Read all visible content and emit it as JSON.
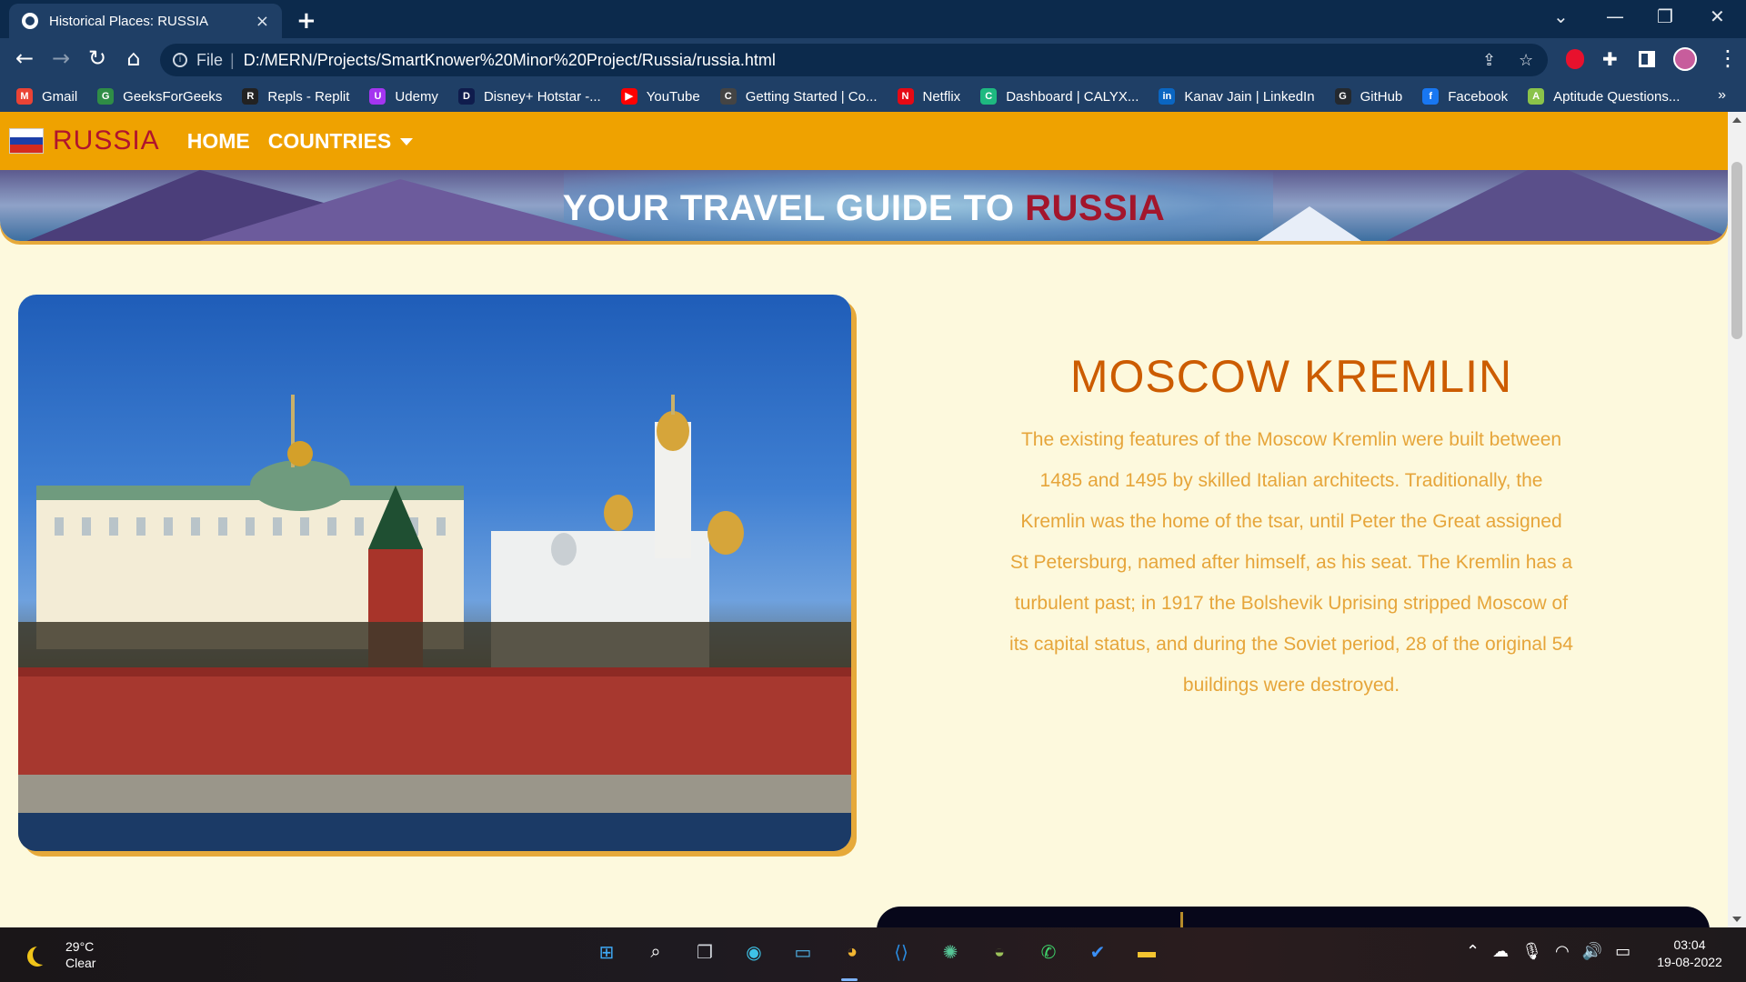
{
  "browser": {
    "tab_title": "Historical Places: RUSSIA",
    "tab_close": "×",
    "new_tab": "+",
    "url_prefix": "File",
    "url_separator": "|",
    "url": "D:/MERN/Projects/SmartKnower%20Minor%20Project/Russia/russia.html",
    "bookmarks": [
      {
        "label": "Gmail",
        "icon": "gmail-icon",
        "color": "#ea4335",
        "glyph": "M"
      },
      {
        "label": "GeeksForGeeks",
        "icon": "geeksforgeeks-icon",
        "color": "#2f8d46",
        "glyph": "G"
      },
      {
        "label": "Repls - Replit",
        "icon": "replit-icon",
        "color": "#222222",
        "glyph": "R"
      },
      {
        "label": "Udemy",
        "icon": "udemy-icon",
        "color": "#a435f0",
        "glyph": "U"
      },
      {
        "label": "Disney+ Hotstar -...",
        "icon": "hotstar-icon",
        "color": "#0f1c4d",
        "glyph": "D"
      },
      {
        "label": "YouTube",
        "icon": "youtube-icon",
        "color": "#ff0000",
        "glyph": "▶"
      },
      {
        "label": "Getting Started | Co...",
        "icon": "codechef-icon",
        "color": "#444444",
        "glyph": "C"
      },
      {
        "label": "Netflix",
        "icon": "netflix-icon",
        "color": "#e50914",
        "glyph": "N"
      },
      {
        "label": "Dashboard | CALYX...",
        "icon": "calyx-icon",
        "color": "#1eb980",
        "glyph": "C"
      },
      {
        "label": "Kanav Jain | LinkedIn",
        "icon": "linkedin-icon",
        "color": "#0a66c2",
        "glyph": "in"
      },
      {
        "label": "GitHub",
        "icon": "github-icon",
        "color": "#24292f",
        "glyph": "G"
      },
      {
        "label": "Facebook",
        "icon": "facebook-icon",
        "color": "#1877f2",
        "glyph": "f"
      },
      {
        "label": "Aptitude Questions...",
        "icon": "aptitude-icon",
        "color": "#8bc34a",
        "glyph": "A"
      }
    ],
    "bookmarks_more": "»"
  },
  "site": {
    "brand": "RUSSIA",
    "nav_home": "HOME",
    "nav_countries": "COUNTRIES",
    "hero_prefix": "YOUR TRAVEL GUIDE TO",
    "hero_accent": "RUSSIA",
    "place_title": "MOSCOW KREMLIN",
    "place_description": "The existing features of the Moscow Kremlin were built between 1485 and 1495 by skilled Italian architects. Traditionally, the Kremlin was the home of the tsar, until Peter the Great assigned St Petersburg, named after himself, as his seat. The Kremlin has a turbulent past; in 1917 the Bolshevik Uprising stripped Moscow of its capital status, and during the Soviet period, 28 of the original 54 buildings were destroyed.",
    "colors": {
      "nav_bg": "#efa200",
      "brand": "#b0142d",
      "page_bg": "#fdf9dd",
      "title": "#cc5c00",
      "desc": "#e6a53a"
    }
  },
  "taskbar": {
    "temperature": "29°C",
    "condition": "Clear",
    "time": "03:04",
    "date": "19-08-2022"
  }
}
